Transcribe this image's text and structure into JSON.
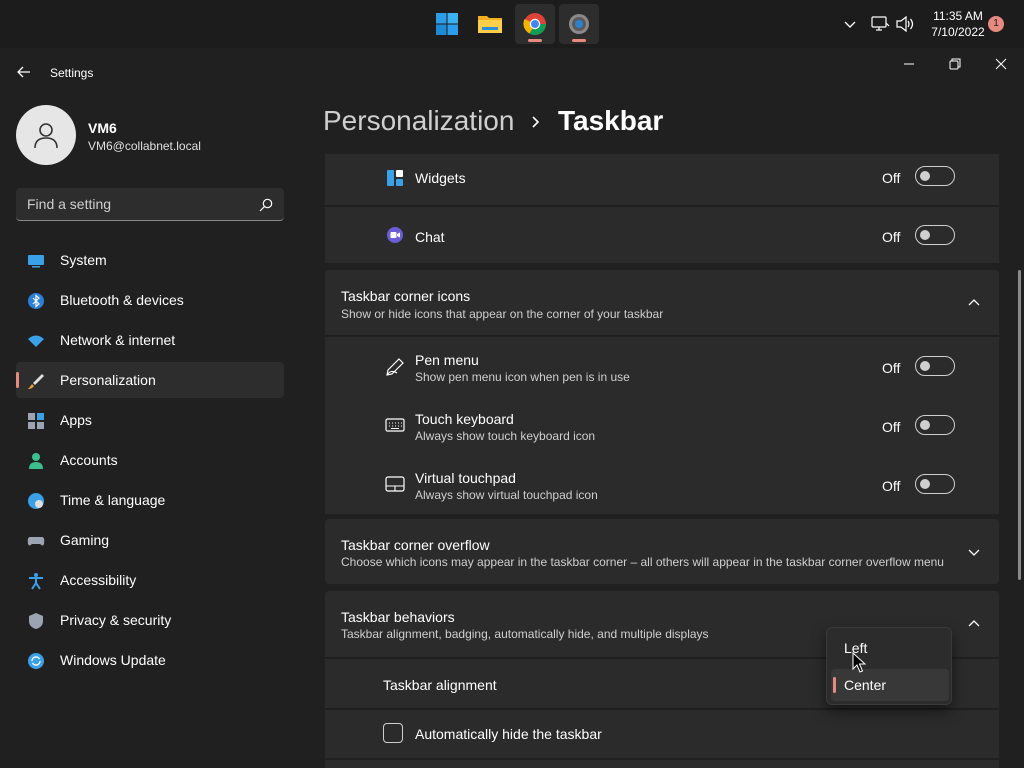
{
  "taskbar": {
    "apps": [
      {
        "name": "start-icon"
      },
      {
        "name": "file-explorer-icon"
      },
      {
        "name": "chrome-icon"
      },
      {
        "name": "settings-icon"
      }
    ],
    "clock_time": "11:35 AM",
    "clock_date": "7/10/2022",
    "notification_count": "1"
  },
  "window": {
    "title": "Settings"
  },
  "profile": {
    "name": "VM6",
    "email": "VM6@collabnet.local"
  },
  "search": {
    "placeholder": "Find a setting"
  },
  "nav": {
    "items": [
      {
        "label": "System",
        "icon": "system-icon"
      },
      {
        "label": "Bluetooth & devices",
        "icon": "bluetooth-icon"
      },
      {
        "label": "Network & internet",
        "icon": "wifi-icon"
      },
      {
        "label": "Personalization",
        "icon": "brush-icon",
        "selected": true
      },
      {
        "label": "Apps",
        "icon": "apps-icon"
      },
      {
        "label": "Accounts",
        "icon": "accounts-icon"
      },
      {
        "label": "Time & language",
        "icon": "globe-icon"
      },
      {
        "label": "Gaming",
        "icon": "gamepad-icon"
      },
      {
        "label": "Accessibility",
        "icon": "accessibility-icon"
      },
      {
        "label": "Privacy & security",
        "icon": "shield-icon"
      },
      {
        "label": "Windows Update",
        "icon": "update-icon"
      }
    ]
  },
  "breadcrumb": {
    "parent": "Personalization",
    "current": "Taskbar"
  },
  "content": {
    "widgets": {
      "label": "Widgets",
      "state": "Off"
    },
    "chat": {
      "label": "Chat",
      "state": "Off"
    },
    "corner_icons": {
      "title": "Taskbar corner icons",
      "subtitle": "Show or hide icons that appear on the corner of your taskbar"
    },
    "pen_menu": {
      "title": "Pen menu",
      "subtitle": "Show pen menu icon when pen is in use",
      "state": "Off"
    },
    "touch_keyboard": {
      "title": "Touch keyboard",
      "subtitle": "Always show touch keyboard icon",
      "state": "Off"
    },
    "virtual_touchpad": {
      "title": "Virtual touchpad",
      "subtitle": "Always show virtual touchpad icon",
      "state": "Off"
    },
    "corner_overflow": {
      "title": "Taskbar corner overflow",
      "subtitle": "Choose which icons may appear in the taskbar corner – all others will appear in the taskbar corner overflow menu"
    },
    "behaviors": {
      "title": "Taskbar behaviors",
      "subtitle": "Taskbar alignment, badging, automatically hide, and multiple displays"
    },
    "alignment": {
      "label": "Taskbar alignment",
      "options": [
        "Left",
        "Center"
      ],
      "selected": "Center"
    },
    "auto_hide": {
      "label": "Automatically hide the taskbar",
      "checked": false
    }
  },
  "colors": {
    "accent": "#e6897e",
    "background": "#202020",
    "card": "#2b2b2b"
  }
}
